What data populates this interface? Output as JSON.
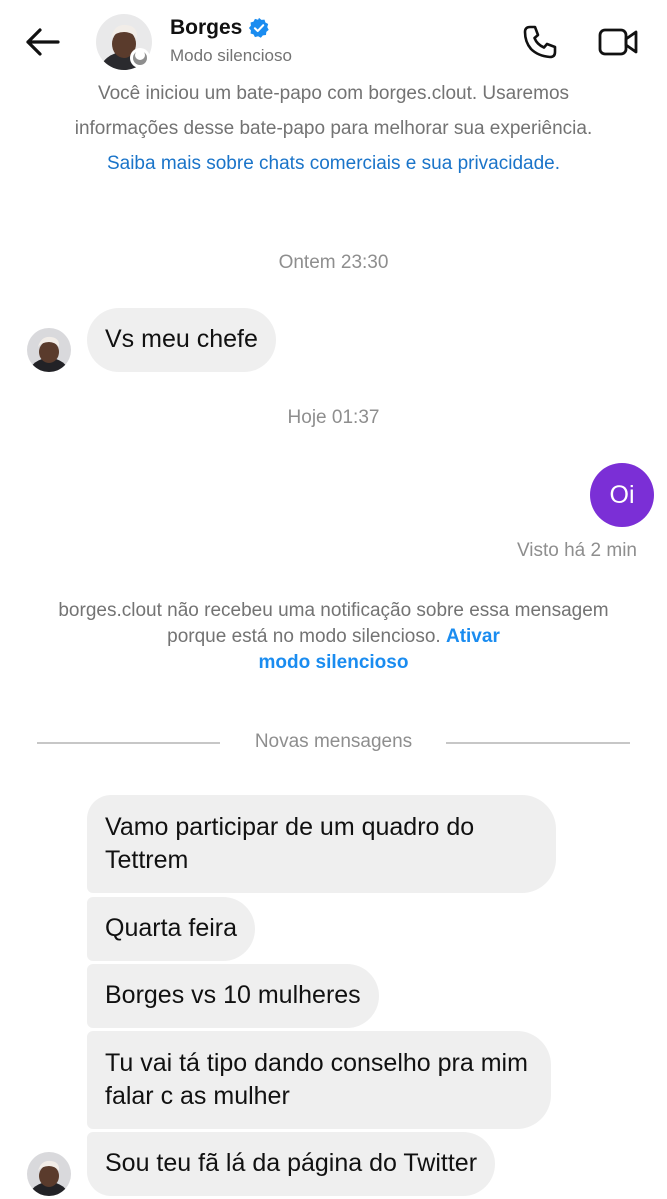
{
  "header": {
    "name": "Borges",
    "status": "Modo silencioso",
    "icons": [
      "back-arrow-icon",
      "verified-badge-icon",
      "phone-icon",
      "video-camera-icon"
    ],
    "accent_verified": "#1a8cf0"
  },
  "info": {
    "line1": "Você iniciou um bate-papo com borges.clout. Usaremos",
    "line2": "informações desse bate-papo para melhorar sua experiência.",
    "link": "Saiba mais sobre chats comerciais e sua privacidade."
  },
  "timestamps": {
    "first": "Ontem 23:30",
    "second": "Hoje 01:37"
  },
  "messages": {
    "m1": "Vs meu chefe",
    "m2": "Oi",
    "m3": "Vamo participar de um quadro do Tettrem",
    "m4": "Quarta feira",
    "m5": "Borges vs 10 mulheres",
    "m6": "Tu vai tá tipo dando conselho pra mim falar c as mulher",
    "m7": "Sou teu fã lá da página do Twitter"
  },
  "seen": "Visto há 2 min",
  "notice": {
    "text": "borges.clout não recebeu uma notificação sobre essa mensagem porque está no modo silencioso.",
    "link_part1": "Ativar",
    "link_part2": "modo silencioso"
  },
  "divider": "Novas mensagens",
  "colors": {
    "outgoing_bubble": "#7b2fd6",
    "incoming_bubble": "#efefef",
    "link": "#1a74c9"
  }
}
